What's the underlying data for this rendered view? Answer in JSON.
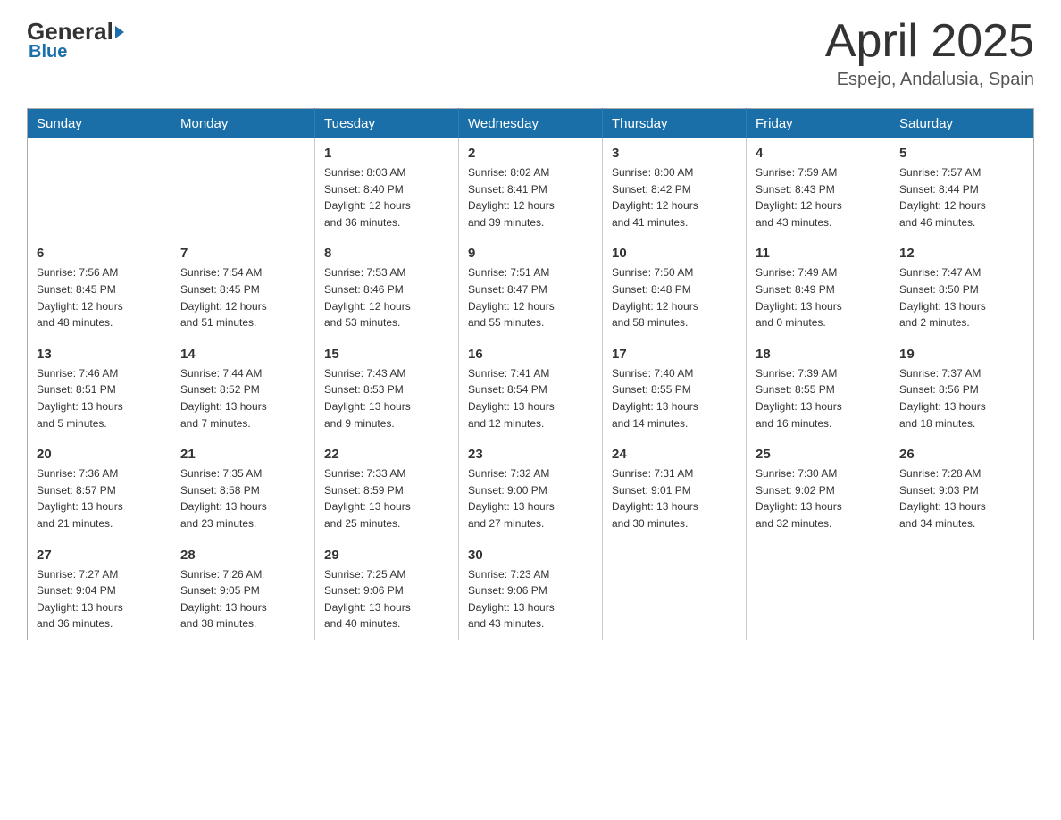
{
  "header": {
    "logo": {
      "general": "General",
      "blue": "Blue",
      "subtitle": "Blue"
    },
    "title": "April 2025",
    "location": "Espejo, Andalusia, Spain"
  },
  "days_of_week": [
    "Sunday",
    "Monday",
    "Tuesday",
    "Wednesday",
    "Thursday",
    "Friday",
    "Saturday"
  ],
  "weeks": [
    [
      {
        "day": "",
        "info": ""
      },
      {
        "day": "",
        "info": ""
      },
      {
        "day": "1",
        "info": "Sunrise: 8:03 AM\nSunset: 8:40 PM\nDaylight: 12 hours\nand 36 minutes."
      },
      {
        "day": "2",
        "info": "Sunrise: 8:02 AM\nSunset: 8:41 PM\nDaylight: 12 hours\nand 39 minutes."
      },
      {
        "day": "3",
        "info": "Sunrise: 8:00 AM\nSunset: 8:42 PM\nDaylight: 12 hours\nand 41 minutes."
      },
      {
        "day": "4",
        "info": "Sunrise: 7:59 AM\nSunset: 8:43 PM\nDaylight: 12 hours\nand 43 minutes."
      },
      {
        "day": "5",
        "info": "Sunrise: 7:57 AM\nSunset: 8:44 PM\nDaylight: 12 hours\nand 46 minutes."
      }
    ],
    [
      {
        "day": "6",
        "info": "Sunrise: 7:56 AM\nSunset: 8:45 PM\nDaylight: 12 hours\nand 48 minutes."
      },
      {
        "day": "7",
        "info": "Sunrise: 7:54 AM\nSunset: 8:45 PM\nDaylight: 12 hours\nand 51 minutes."
      },
      {
        "day": "8",
        "info": "Sunrise: 7:53 AM\nSunset: 8:46 PM\nDaylight: 12 hours\nand 53 minutes."
      },
      {
        "day": "9",
        "info": "Sunrise: 7:51 AM\nSunset: 8:47 PM\nDaylight: 12 hours\nand 55 minutes."
      },
      {
        "day": "10",
        "info": "Sunrise: 7:50 AM\nSunset: 8:48 PM\nDaylight: 12 hours\nand 58 minutes."
      },
      {
        "day": "11",
        "info": "Sunrise: 7:49 AM\nSunset: 8:49 PM\nDaylight: 13 hours\nand 0 minutes."
      },
      {
        "day": "12",
        "info": "Sunrise: 7:47 AM\nSunset: 8:50 PM\nDaylight: 13 hours\nand 2 minutes."
      }
    ],
    [
      {
        "day": "13",
        "info": "Sunrise: 7:46 AM\nSunset: 8:51 PM\nDaylight: 13 hours\nand 5 minutes."
      },
      {
        "day": "14",
        "info": "Sunrise: 7:44 AM\nSunset: 8:52 PM\nDaylight: 13 hours\nand 7 minutes."
      },
      {
        "day": "15",
        "info": "Sunrise: 7:43 AM\nSunset: 8:53 PM\nDaylight: 13 hours\nand 9 minutes."
      },
      {
        "day": "16",
        "info": "Sunrise: 7:41 AM\nSunset: 8:54 PM\nDaylight: 13 hours\nand 12 minutes."
      },
      {
        "day": "17",
        "info": "Sunrise: 7:40 AM\nSunset: 8:55 PM\nDaylight: 13 hours\nand 14 minutes."
      },
      {
        "day": "18",
        "info": "Sunrise: 7:39 AM\nSunset: 8:55 PM\nDaylight: 13 hours\nand 16 minutes."
      },
      {
        "day": "19",
        "info": "Sunrise: 7:37 AM\nSunset: 8:56 PM\nDaylight: 13 hours\nand 18 minutes."
      }
    ],
    [
      {
        "day": "20",
        "info": "Sunrise: 7:36 AM\nSunset: 8:57 PM\nDaylight: 13 hours\nand 21 minutes."
      },
      {
        "day": "21",
        "info": "Sunrise: 7:35 AM\nSunset: 8:58 PM\nDaylight: 13 hours\nand 23 minutes."
      },
      {
        "day": "22",
        "info": "Sunrise: 7:33 AM\nSunset: 8:59 PM\nDaylight: 13 hours\nand 25 minutes."
      },
      {
        "day": "23",
        "info": "Sunrise: 7:32 AM\nSunset: 9:00 PM\nDaylight: 13 hours\nand 27 minutes."
      },
      {
        "day": "24",
        "info": "Sunrise: 7:31 AM\nSunset: 9:01 PM\nDaylight: 13 hours\nand 30 minutes."
      },
      {
        "day": "25",
        "info": "Sunrise: 7:30 AM\nSunset: 9:02 PM\nDaylight: 13 hours\nand 32 minutes."
      },
      {
        "day": "26",
        "info": "Sunrise: 7:28 AM\nSunset: 9:03 PM\nDaylight: 13 hours\nand 34 minutes."
      }
    ],
    [
      {
        "day": "27",
        "info": "Sunrise: 7:27 AM\nSunset: 9:04 PM\nDaylight: 13 hours\nand 36 minutes."
      },
      {
        "day": "28",
        "info": "Sunrise: 7:26 AM\nSunset: 9:05 PM\nDaylight: 13 hours\nand 38 minutes."
      },
      {
        "day": "29",
        "info": "Sunrise: 7:25 AM\nSunset: 9:06 PM\nDaylight: 13 hours\nand 40 minutes."
      },
      {
        "day": "30",
        "info": "Sunrise: 7:23 AM\nSunset: 9:06 PM\nDaylight: 13 hours\nand 43 minutes."
      },
      {
        "day": "",
        "info": ""
      },
      {
        "day": "",
        "info": ""
      },
      {
        "day": "",
        "info": ""
      }
    ]
  ]
}
